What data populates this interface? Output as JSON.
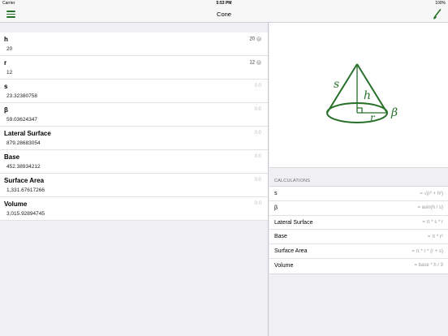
{
  "status": {
    "carrier": "Carrier",
    "time": "5:53 PM",
    "battery": "100%"
  },
  "nav": {
    "title": "Cone"
  },
  "colors": {
    "accent": "#27702a"
  },
  "inputs": [
    {
      "label": "h",
      "value": "20",
      "right": "20",
      "set": true
    },
    {
      "label": "r",
      "value": "12",
      "right": "12",
      "set": true
    },
    {
      "label": "s",
      "value": "23.32380758",
      "right": "0.0",
      "set": false
    },
    {
      "label": "β",
      "value": "59.03624347",
      "right": "0.0",
      "set": false
    },
    {
      "label": "Lateral Surface",
      "value": "879.28683054",
      "right": "0.0",
      "set": false
    },
    {
      "label": "Base",
      "value": "452.38934212",
      "right": "0.0",
      "set": false
    },
    {
      "label": "Surface Area",
      "value": "1,331.67617266",
      "right": "0.0",
      "set": false
    },
    {
      "label": "Volume",
      "value": "3,015.92894745",
      "right": "0.0",
      "set": false
    }
  ],
  "diagram": {
    "labels": {
      "s": "s",
      "h": "h",
      "r": "r",
      "beta": "β"
    }
  },
  "calculations": {
    "header": "CALCULATIONS",
    "rows": [
      {
        "name": "s",
        "formula": "= √(r² + h²)"
      },
      {
        "name": "β",
        "formula": "= asin(h / s)"
      },
      {
        "name": "Lateral Surface",
        "formula": "= π * s * r"
      },
      {
        "name": "Base",
        "formula": "= π * r²"
      },
      {
        "name": "Surface Area",
        "formula": "= π * r * (r + s)"
      },
      {
        "name": "Volume",
        "formula": "= base * h / 3"
      }
    ]
  }
}
